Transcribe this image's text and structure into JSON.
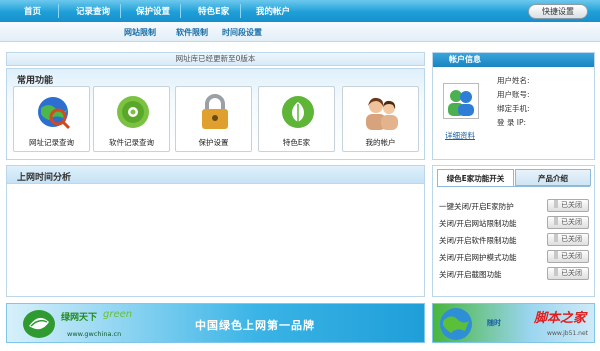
{
  "nav": {
    "items": [
      "首页",
      "记录查询",
      "保护设置",
      "特色E家",
      "我的帐户"
    ],
    "quick_settings": "快捷设置"
  },
  "subnav": {
    "items": [
      "网站限制",
      "软件限制",
      "时间段设置"
    ]
  },
  "notice": "网址库已经更新至0版本",
  "common": {
    "title": "常用功能",
    "tiles": [
      {
        "label": "网址记录查询",
        "icon": "globe-search-icon"
      },
      {
        "label": "软件记录查询",
        "icon": "cd-disc-icon"
      },
      {
        "label": "保护设置",
        "icon": "padlock-icon"
      },
      {
        "label": "特色E家",
        "icon": "leaf-icon"
      },
      {
        "label": "我的帐户",
        "icon": "users-icon"
      }
    ]
  },
  "analysis": {
    "title": "上网时间分析"
  },
  "account": {
    "title": "帐户信息",
    "fields": [
      "用户姓名:",
      "用户账号:",
      "绑定手机:",
      "登 录 IP:"
    ],
    "detail_link": "详细资料"
  },
  "features": {
    "tabs": [
      "绿色E家功能开关",
      "产品介绍"
    ],
    "rows": [
      {
        "label": "一键关闭/开启E家防护",
        "state": "已关闭"
      },
      {
        "label": "关闭/开启网站限制功能",
        "state": "已关闭"
      },
      {
        "label": "关闭/开启软件限制功能",
        "state": "已关闭"
      },
      {
        "label": "关闭/开启网护模式功能",
        "state": "已关闭"
      },
      {
        "label": "关闭/开启截图功能",
        "state": "已关闭"
      }
    ]
  },
  "banner": {
    "brand": "绿网天下",
    "brand_en": "green",
    "url": "www.gwchina.cn",
    "slogan": "中国绿色上网第一品牌"
  },
  "ad": {
    "title": "脚本之家",
    "subtitle": "www.jb51.net",
    "side_text": "随时"
  },
  "colors": {
    "accent": "#1e9fd8",
    "link": "#1a5fa0"
  }
}
